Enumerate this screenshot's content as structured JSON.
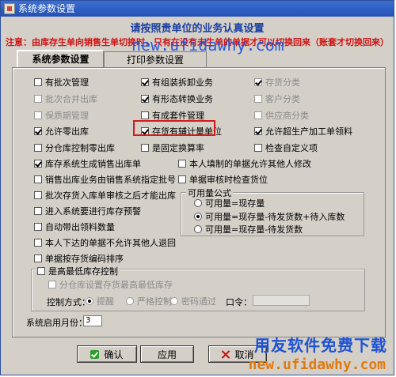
{
  "window": {
    "title": "系统参数设置"
  },
  "header": {
    "heading": "请按照贵单位的业务认真设置",
    "notice": "注意：由库存生单向销售生单切换时，只有在没有未生单的单据才可以切换回来（账套才切换回来）",
    "watermark": "new.ufidawhy.com"
  },
  "tabs": [
    {
      "label": "系统参数设置"
    },
    {
      "label": "打印参数设置"
    }
  ],
  "options": {
    "c1": [
      "有批次管理",
      "批次合并出库",
      "保质期管理",
      "允许零出库",
      "分仓库控制零出库",
      "库存系统生成销售出库单",
      "销售出库业务由销售系统指定批号",
      "批次存货入库单审核之后才能出库",
      "进入系统要进行库存预警",
      "自动带出领料数量",
      "本人下达的单据不允许其他人退回",
      "单据按存货编码排序"
    ],
    "c2": [
      "有组装拆卸业务",
      "有形态转换业务",
      "有成套件管理",
      "存货有辅计量单位",
      "是固定换算率"
    ],
    "c3": [
      "存货分类",
      "客户分类",
      "供应商分类",
      "允许超生产加工单领料",
      "检查自定义项"
    ],
    "c4": [
      "本人填制的单据允许其他人修改",
      "单据审核时检查货位"
    ]
  },
  "available_qty": {
    "title": "可用量公式",
    "options": [
      "可用量=现存量",
      "可用量=现存量-待发货数+待入库数",
      "可用量=现存量-待发货数"
    ]
  },
  "max_stock": {
    "label": "是高最低库存控制",
    "sub_label": "分仓库设置存货最高最低库存",
    "mode_label": "控制方式：",
    "modes": [
      "提醒",
      "严格控制",
      "密码通过"
    ],
    "password_label": "口令："
  },
  "start_month": {
    "label": "系统启用月份：",
    "value": "3"
  },
  "buttons": {
    "ok": "确认",
    "apply": "应用",
    "cancel": "取消"
  },
  "watermark_bottom": {
    "cn": "用友软件免费下载",
    "url": "new.ufidawhy.com"
  }
}
